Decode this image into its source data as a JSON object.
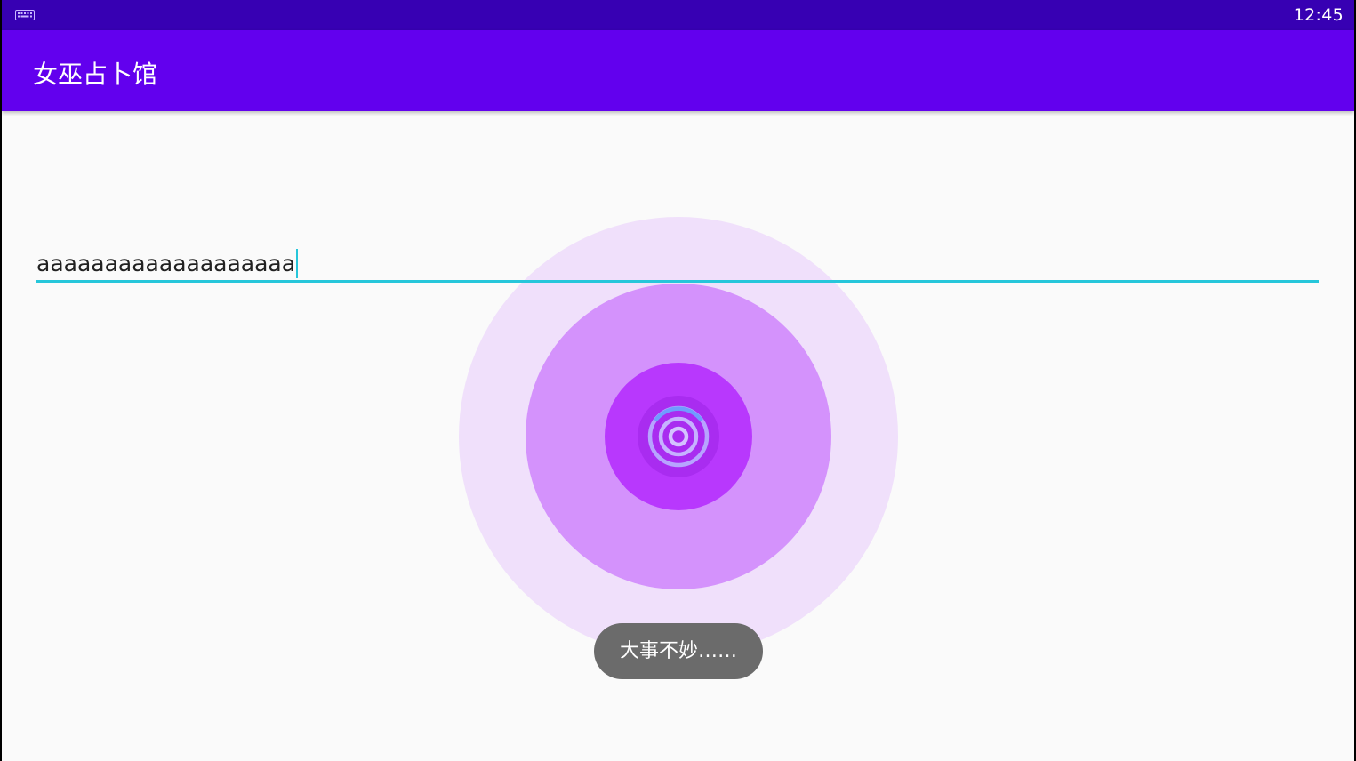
{
  "status_bar": {
    "time": "12:45",
    "left_icon": "keyboard-icon"
  },
  "app_bar": {
    "title": "女巫占卜馆"
  },
  "input": {
    "value": "aaaaaaaaaaaaaaaaaaa",
    "focused": true
  },
  "animation": {
    "icon": "ripple-rings-icon"
  },
  "toast": {
    "message": "大事不妙……"
  },
  "colors": {
    "status_bar": "#3700b3",
    "app_bar": "#6200ee",
    "accent": "#26c6da",
    "ripple_outer": "#f0e0fb",
    "ripple_middle": "#d492fc",
    "ripple_inner": "#b838fd",
    "ring": "#a080ff",
    "toast_bg": "#6b6b6b",
    "background": "#fafafa"
  }
}
